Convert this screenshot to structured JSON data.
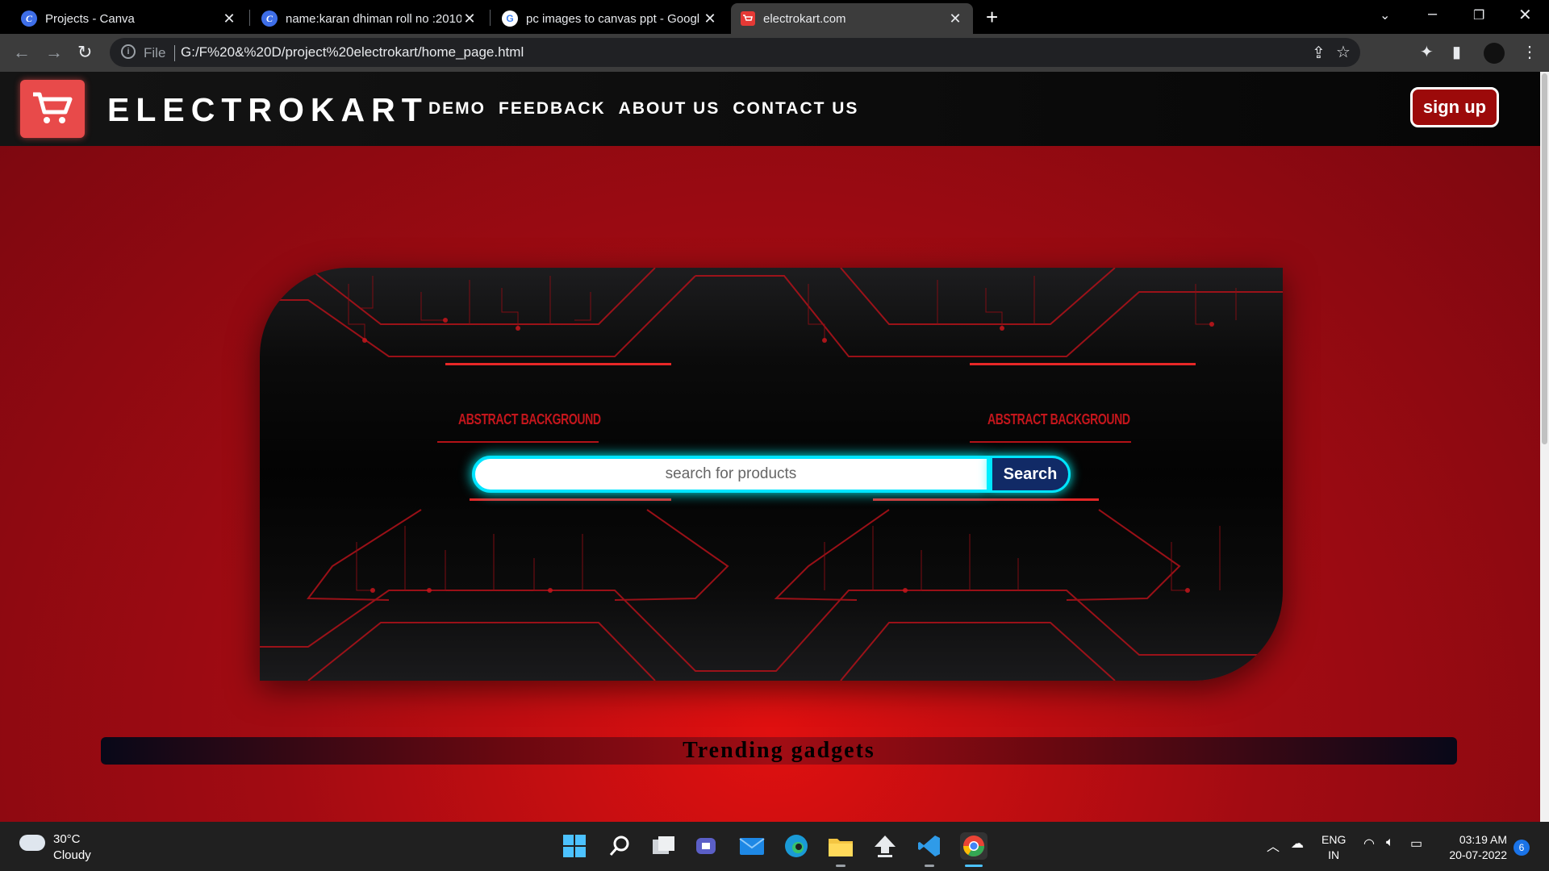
{
  "browser": {
    "tabs": [
      {
        "title": "Projects - Canva",
        "favicon": "canva-icon",
        "active": false
      },
      {
        "title": "name:karan dhiman roll no :2010",
        "favicon": "canva-icon",
        "active": false
      },
      {
        "title": "pc images to canvas ppt - Googl",
        "favicon": "google-icon",
        "active": false
      },
      {
        "title": "electrokart.com",
        "favicon": "electrokart-icon",
        "active": true
      }
    ],
    "new_tab": "+",
    "address": {
      "scheme_label": "File",
      "url": "G:/F%20&%20D/project%20electrokart/home_page.html"
    }
  },
  "site": {
    "brand": "ELECTROKART",
    "nav": [
      "DEMO",
      "FEEDBACK",
      "ABOUT US",
      "CONTACT US"
    ],
    "signup_label": "sign up",
    "hero": {
      "abstract_text": "ABSTRACT BACKGROUND",
      "search_placeholder": "search for products",
      "search_button": "Search"
    },
    "trending_title": "Trending gadgets"
  },
  "taskbar": {
    "weather": {
      "temp": "30°C",
      "desc": "Cloudy"
    },
    "lang": [
      "ENG",
      "IN"
    ],
    "time": "03:19 AM",
    "date": "20-07-2022",
    "notifications": "6"
  },
  "colors": {
    "accent_red": "#e84a4a",
    "search_glow": "#00e5ff",
    "search_button": "#112a66",
    "page_red": "#a20b12"
  }
}
